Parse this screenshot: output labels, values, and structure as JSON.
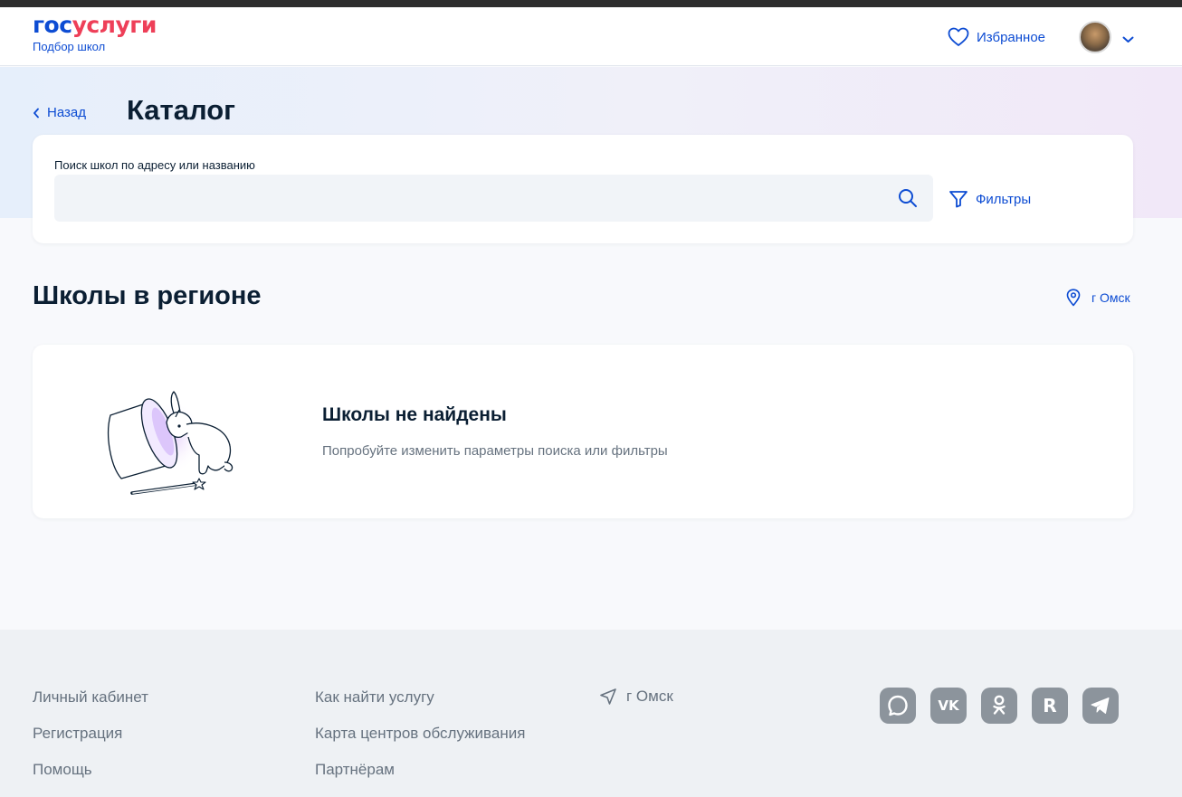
{
  "header": {
    "logo_part1": "гос",
    "logo_part2": "услуги",
    "subtitle": "Подбор школ",
    "favorites_label": "Избранное"
  },
  "hero": {
    "back_label": "Назад",
    "title": "Каталог"
  },
  "search": {
    "label": "Поиск школ по адресу или названию",
    "value": "",
    "placeholder": "",
    "filters_label": "Фильтры"
  },
  "section": {
    "title": "Школы в регионе",
    "region": "г Омск"
  },
  "empty_state": {
    "title": "Школы не найдены",
    "subtitle": "Попробуйте изменить параметры поиска или фильтры"
  },
  "footer": {
    "col1": [
      "Личный кабинет",
      "Регистрация",
      "Помощь"
    ],
    "col2": [
      "Как найти услугу",
      "Карта центров обслуживания",
      "Партнёрам"
    ],
    "city": "г Омск",
    "socials": [
      "max-icon",
      "vk-icon",
      "ok-icon",
      "rutube-icon",
      "telegram-icon"
    ]
  },
  "colors": {
    "accent": "#0d4cd3",
    "brand_red": "#ee3f58",
    "text": "#0b1f33",
    "muted": "#66727f"
  }
}
